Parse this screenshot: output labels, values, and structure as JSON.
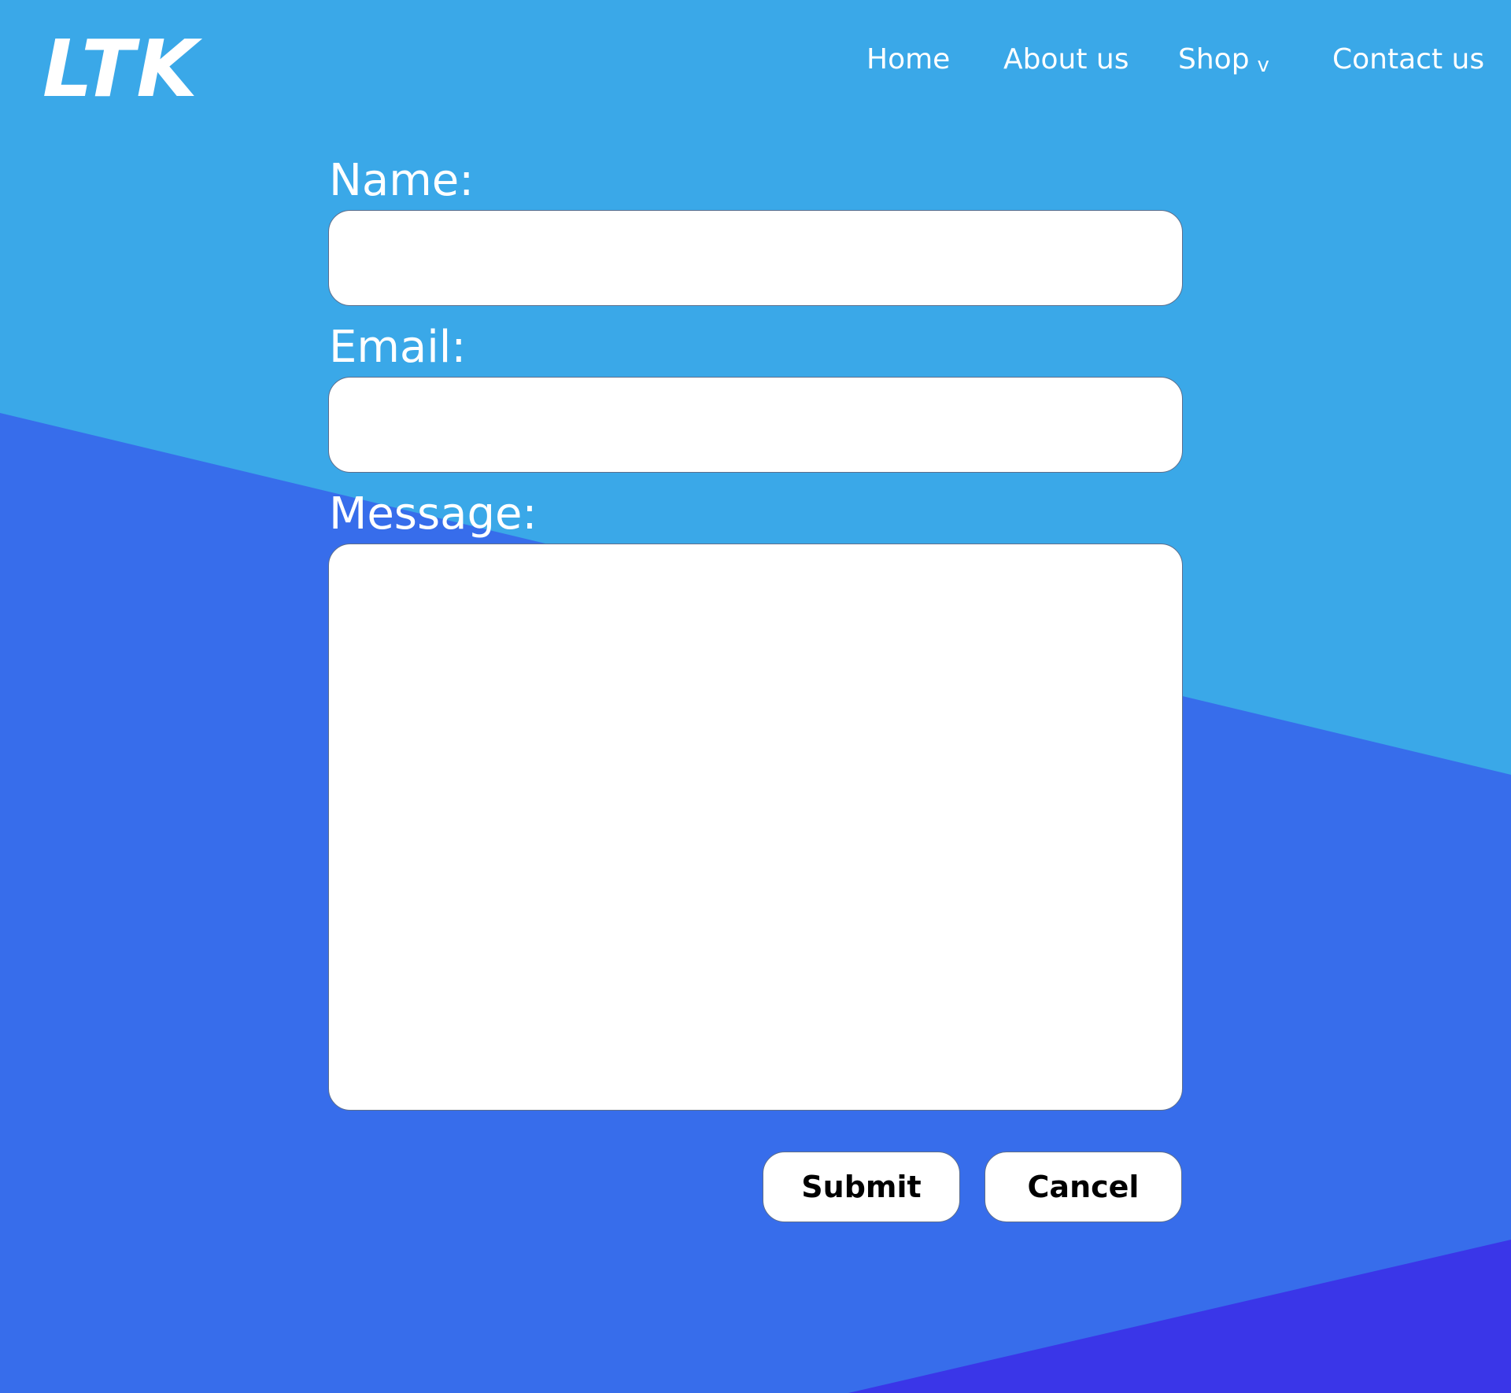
{
  "colors": {
    "sky_blue": "#3aa8e8",
    "royal_blue": "#376deb",
    "deep_blue": "#3a36e8",
    "text_white": "#ffffff",
    "button_text": "#000000"
  },
  "header": {
    "logo": "LTK",
    "nav": {
      "home": "Home",
      "about": "About us",
      "shop": "Shop",
      "shop_chevron": "v",
      "contact": "Contact us"
    }
  },
  "form": {
    "name_label": "Name:",
    "name_value": "",
    "email_label": "Email:",
    "email_value": "",
    "message_label": "Message:",
    "message_value": "",
    "submit_label": "Submit",
    "cancel_label": "Cancel"
  }
}
